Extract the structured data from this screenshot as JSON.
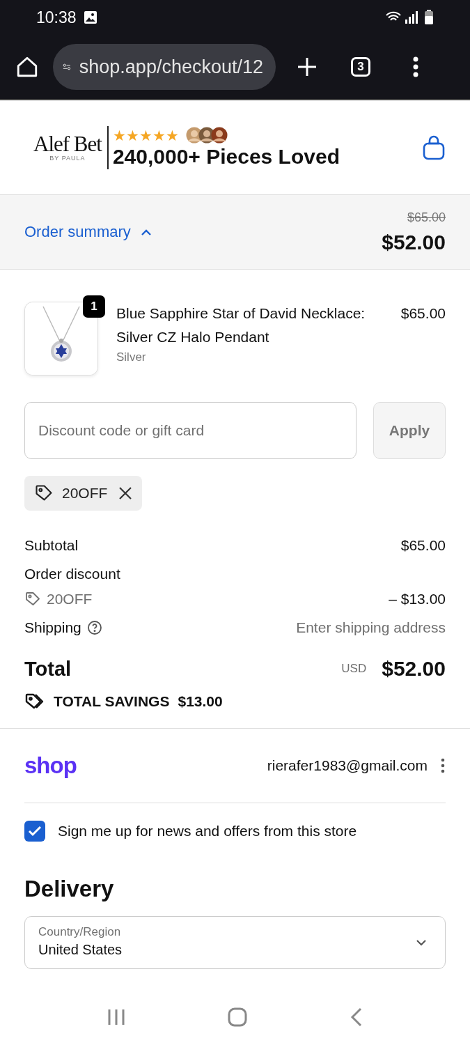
{
  "status_bar": {
    "time": "10:38"
  },
  "browser": {
    "url": "shop.app/checkout/12",
    "tab_count": "3"
  },
  "store": {
    "logo": "Alef Bet",
    "logo_sub": "BY PAULA",
    "stars": 5,
    "tagline": "240,000+ Pieces Loved"
  },
  "order_summary": {
    "label": "Order summary",
    "expanded": true,
    "original_price": "$65.00",
    "price": "$52.00"
  },
  "items": [
    {
      "quantity": "1",
      "name": "Blue Sapphire Star of David Necklace: Silver CZ Halo Pendant",
      "variant": "Silver",
      "price": "$65.00"
    }
  ],
  "discount": {
    "placeholder": "Discount code or gift card",
    "button": "Apply",
    "applied": [
      {
        "code": "20OFF"
      }
    ]
  },
  "totals": {
    "subtotal_label": "Subtotal",
    "subtotal": "$65.00",
    "discount_label": "Order discount",
    "discount_code": "20OFF",
    "discount_amount": "– $13.00",
    "shipping_label": "Shipping",
    "shipping_value": "Enter shipping address",
    "total_label": "Total",
    "currency": "USD",
    "total": "$52.00",
    "savings_label": "TOTAL SAVINGS",
    "savings": "$13.00"
  },
  "shop_account": {
    "logo": "shop",
    "email": "rierafer1983@gmail.com"
  },
  "newsletter": {
    "label": "Sign me up for news and offers from this store",
    "checked": true
  },
  "delivery": {
    "heading": "Delivery",
    "country_label": "Country/Region",
    "country": "United States"
  }
}
